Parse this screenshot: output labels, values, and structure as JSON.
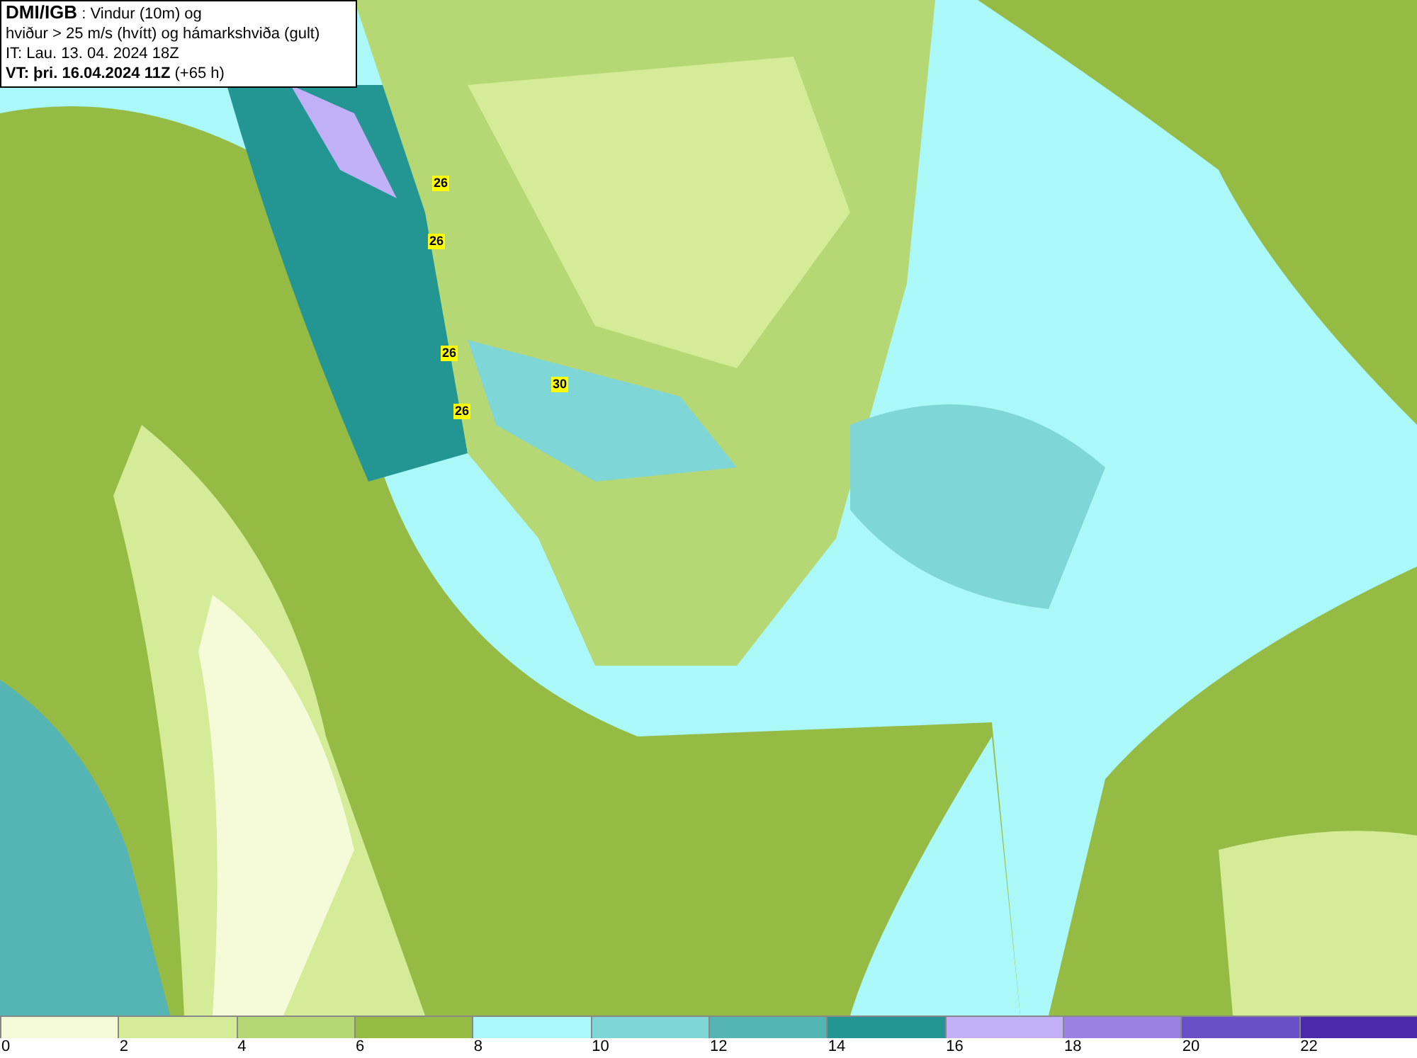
{
  "title_box": {
    "source": "DMI/IGB",
    "lines": [
      " : Vindur (10m) og",
      "hviður > 25 m/s (hvítt) og hámarkshviða (gult)",
      "IT: Lau. 13. 04. 2024 18Z"
    ],
    "valid_time": "VT: þri. 16.04.2024 11Z",
    "lead": "(+65 h)"
  },
  "gust_labels": [
    "26",
    "26",
    "26",
    "30",
    "26"
  ],
  "legend": [
    {
      "label": "0",
      "color": "#f5fbd8"
    },
    {
      "label": "2",
      "color": "#d4ec98"
    },
    {
      "label": "4",
      "color": "#b5d874"
    },
    {
      "label": "6",
      "color": "#96bb45"
    },
    {
      "label": "8",
      "color": "#aaf8f8"
    },
    {
      "label": "10",
      "color": "#7fd6d6"
    },
    {
      "label": "12",
      "color": "#55b5b5"
    },
    {
      "label": "14",
      "color": "#239593"
    },
    {
      "label": "16",
      "color": "#c2b0f6"
    },
    {
      "label": "18",
      "color": "#9a82e2"
    },
    {
      "label": "20",
      "color": "#6a50c8"
    },
    {
      "label": "22",
      "color": "#4a2aa8"
    }
  ]
}
